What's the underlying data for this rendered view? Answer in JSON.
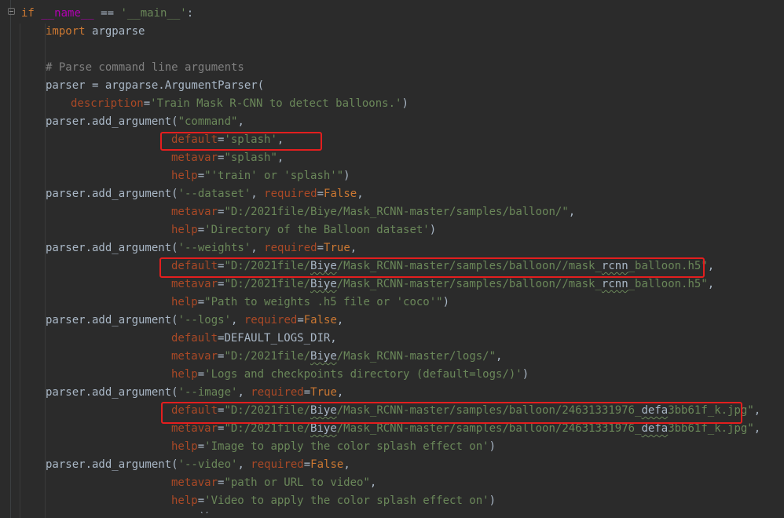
{
  "lines": [
    {
      "id": "l1",
      "parts": [
        [
          "kw",
          "if "
        ],
        [
          "dn",
          "__name__"
        ],
        [
          "fn",
          " == "
        ],
        [
          "str",
          "'__main__'"
        ],
        [
          "fn",
          ":"
        ]
      ]
    },
    {
      "id": "l2",
      "parts": [
        [
          "kw",
          "import "
        ],
        [
          "fn",
          "argparse"
        ]
      ]
    },
    {
      "id": "l3",
      "parts": []
    },
    {
      "id": "l4",
      "parts": [
        [
          "cmt",
          "# Parse command line arguments"
        ]
      ]
    },
    {
      "id": "l5",
      "parts": [
        [
          "fn",
          "parser = argparse.ArgumentParser("
        ]
      ]
    },
    {
      "id": "l6",
      "parts": [
        [
          "par",
          "description"
        ],
        [
          "fn",
          "="
        ],
        [
          "str",
          "'Train Mask R-CNN to detect balloons.'"
        ],
        [
          "fn",
          ")"
        ]
      ]
    },
    {
      "id": "l7",
      "parts": [
        [
          "fn",
          "parser.add_argument("
        ],
        [
          "str",
          "\"command\""
        ],
        [
          "fn",
          ","
        ]
      ]
    },
    {
      "id": "l8",
      "parts": [
        [
          "par",
          "default"
        ],
        [
          "fn",
          "="
        ],
        [
          "str",
          "'splash'"
        ],
        [
          "fn",
          ","
        ]
      ]
    },
    {
      "id": "l9",
      "parts": [
        [
          "par",
          "metavar"
        ],
        [
          "fn",
          "="
        ],
        [
          "str",
          "\"splash\""
        ],
        [
          "fn",
          ","
        ]
      ]
    },
    {
      "id": "l10",
      "parts": [
        [
          "par",
          "help"
        ],
        [
          "fn",
          "="
        ],
        [
          "str",
          "\"'train' or 'splash'\""
        ],
        [
          "fn",
          ")"
        ]
      ]
    },
    {
      "id": "l11",
      "parts": [
        [
          "fn",
          "parser.add_argument("
        ],
        [
          "str",
          "'--dataset'"
        ],
        [
          "fn",
          ", "
        ],
        [
          "par",
          "required"
        ],
        [
          "fn",
          "="
        ],
        [
          "kw",
          "False"
        ],
        [
          "fn",
          ","
        ]
      ]
    },
    {
      "id": "l12",
      "parts": [
        [
          "par",
          "metavar"
        ],
        [
          "fn",
          "="
        ],
        [
          "str",
          "\"D:/2021file/Biye/Mask_RCNN-master/samples/balloon/\""
        ],
        [
          "fn",
          ","
        ]
      ]
    },
    {
      "id": "l13",
      "parts": [
        [
          "par",
          "help"
        ],
        [
          "fn",
          "="
        ],
        [
          "str",
          "'Directory of the Balloon dataset'"
        ],
        [
          "fn",
          ")"
        ]
      ]
    },
    {
      "id": "l14",
      "parts": [
        [
          "fn",
          "parser.add_argument("
        ],
        [
          "str",
          "'--weights'"
        ],
        [
          "fn",
          ", "
        ],
        [
          "par",
          "required"
        ],
        [
          "fn",
          "="
        ],
        [
          "kw",
          "True"
        ],
        [
          "fn",
          ","
        ]
      ]
    },
    {
      "id": "l15",
      "parts": [
        [
          "par",
          "default"
        ],
        [
          "fn",
          "="
        ],
        [
          "str",
          "\"D:/2021file/"
        ],
        [
          "typo",
          "Biye"
        ],
        [
          "str",
          "/Mask_RCNN-master/samples/balloon//mask_"
        ],
        [
          "typo",
          "rcnn"
        ],
        [
          "str",
          "_balloon.h5\""
        ],
        [
          "fn",
          ","
        ]
      ]
    },
    {
      "id": "l16",
      "parts": [
        [
          "par",
          "metavar"
        ],
        [
          "fn",
          "="
        ],
        [
          "str",
          "\"D:/2021file/"
        ],
        [
          "typo",
          "Biye"
        ],
        [
          "str",
          "/Mask_RCNN-master/samples/balloon//mask_"
        ],
        [
          "typo",
          "rcnn"
        ],
        [
          "str",
          "_balloon.h5\""
        ],
        [
          "fn",
          ","
        ]
      ]
    },
    {
      "id": "l17",
      "parts": [
        [
          "par",
          "help"
        ],
        [
          "fn",
          "="
        ],
        [
          "str",
          "\"Path to weights .h5 file or 'coco'\""
        ],
        [
          "fn",
          ")"
        ]
      ]
    },
    {
      "id": "l18",
      "parts": [
        [
          "fn",
          "parser.add_argument("
        ],
        [
          "str",
          "'--logs'"
        ],
        [
          "fn",
          ", "
        ],
        [
          "par",
          "required"
        ],
        [
          "fn",
          "="
        ],
        [
          "kw",
          "False"
        ],
        [
          "fn",
          ","
        ]
      ]
    },
    {
      "id": "l19",
      "parts": [
        [
          "par",
          "default"
        ],
        [
          "fn",
          "=DEFAULT_LOGS_DIR,"
        ]
      ]
    },
    {
      "id": "l20",
      "parts": [
        [
          "par",
          "metavar"
        ],
        [
          "fn",
          "="
        ],
        [
          "str",
          "\"D:/2021file/"
        ],
        [
          "typo",
          "Biye"
        ],
        [
          "str",
          "/Mask_RCNN-master/logs/\""
        ],
        [
          "fn",
          ","
        ]
      ]
    },
    {
      "id": "l21",
      "parts": [
        [
          "par",
          "help"
        ],
        [
          "fn",
          "="
        ],
        [
          "str",
          "'Logs and checkpoints directory (default=logs/)'"
        ],
        [
          "fn",
          ")"
        ]
      ]
    },
    {
      "id": "l22",
      "parts": [
        [
          "fn",
          "parser.add_argument("
        ],
        [
          "str",
          "'--image'"
        ],
        [
          "fn",
          ", "
        ],
        [
          "par",
          "required"
        ],
        [
          "fn",
          "="
        ],
        [
          "kw",
          "True"
        ],
        [
          "fn",
          ","
        ]
      ]
    },
    {
      "id": "l23",
      "parts": [
        [
          "par",
          "default"
        ],
        [
          "fn",
          "="
        ],
        [
          "str",
          "\"D:/2021file/"
        ],
        [
          "typo",
          "Biye"
        ],
        [
          "str",
          "/Mask_RCNN-master/samples/balloon/24631331976_"
        ],
        [
          "typo",
          "defa"
        ],
        [
          "str",
          "3bb61f_k.jpg\""
        ],
        [
          "fn",
          ","
        ]
      ]
    },
    {
      "id": "l24",
      "parts": [
        [
          "par",
          "metavar"
        ],
        [
          "fn",
          "="
        ],
        [
          "str",
          "\"D:/2021file/"
        ],
        [
          "typo",
          "Biye"
        ],
        [
          "str",
          "/Mask_RCNN-master/samples/balloon/24631331976_"
        ],
        [
          "typo",
          "defa"
        ],
        [
          "str",
          "3bb61f_k.jpg\""
        ],
        [
          "fn",
          ","
        ]
      ]
    },
    {
      "id": "l25",
      "parts": [
        [
          "par",
          "help"
        ],
        [
          "fn",
          "="
        ],
        [
          "str",
          "'Image to apply the color splash effect on'"
        ],
        [
          "fn",
          ")"
        ]
      ]
    },
    {
      "id": "l26",
      "parts": [
        [
          "fn",
          "parser.add_argument("
        ],
        [
          "str",
          "'--video'"
        ],
        [
          "fn",
          ", "
        ],
        [
          "par",
          "required"
        ],
        [
          "fn",
          "="
        ],
        [
          "kw",
          "False"
        ],
        [
          "fn",
          ","
        ]
      ]
    },
    {
      "id": "l27",
      "parts": [
        [
          "par",
          "metavar"
        ],
        [
          "fn",
          "="
        ],
        [
          "str",
          "\"path or URL to video\""
        ],
        [
          "fn",
          ","
        ]
      ]
    },
    {
      "id": "l28",
      "parts": [
        [
          "par",
          "help"
        ],
        [
          "fn",
          "="
        ],
        [
          "str",
          "'Video to apply the color splash effect on'"
        ],
        [
          "fn",
          ")"
        ]
      ]
    },
    {
      "id": "l29",
      "parts": [
        [
          "fn",
          "    ()"
        ]
      ]
    }
  ]
}
